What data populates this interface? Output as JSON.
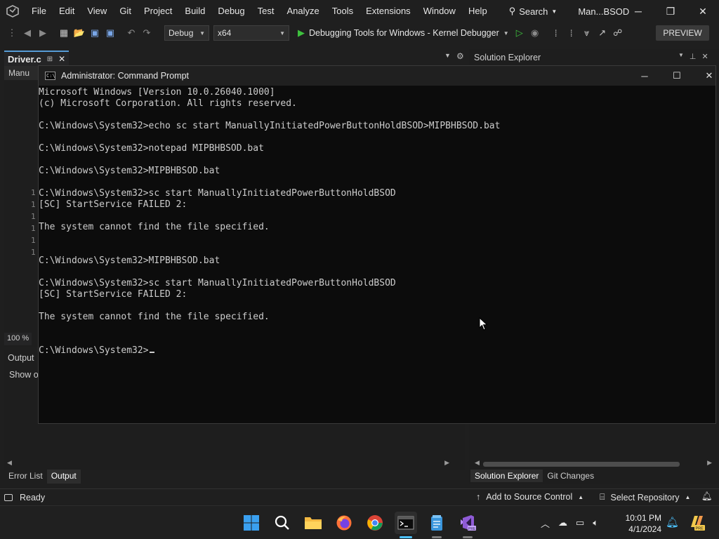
{
  "menubar": {
    "items": [
      "File",
      "Edit",
      "View",
      "Git",
      "Project",
      "Build",
      "Debug",
      "Test",
      "Analyze",
      "Tools",
      "Extensions",
      "Window",
      "Help"
    ],
    "search_label": "Search",
    "title": "Man...BSOD"
  },
  "toolbar": {
    "configuration": "Debug",
    "platform": "x64",
    "debug_target": "Debugging Tools for Windows - Kernel Debugger",
    "preview_label": "PREVIEW"
  },
  "doc_tabs": {
    "active_tab": "Driver.c",
    "editor_strip": "Manu"
  },
  "editor": {
    "line_numbers": [
      "1",
      "1",
      "1",
      "1",
      "1",
      "1"
    ],
    "zoom": "100 %"
  },
  "output": {
    "title": "Output",
    "show_output": "Show o"
  },
  "bottom_tabs": [
    "Error List",
    "Output"
  ],
  "solution_explorer": {
    "title": "Solution Explorer",
    "tabs": [
      "Solution Explorer",
      "Git Changes"
    ]
  },
  "statusbar": {
    "ready": "Ready",
    "add_to_source_control": "Add to Source Control",
    "select_repository": "Select Repository"
  },
  "cmd": {
    "title": "Administrator: Command Prompt",
    "lines": [
      "Microsoft Windows [Version 10.0.26040.1000]",
      "(c) Microsoft Corporation. All rights reserved.",
      "",
      "C:\\Windows\\System32>echo sc start ManuallyInitiatedPowerButtonHoldBSOD>MIPBHBSOD.bat",
      "",
      "C:\\Windows\\System32>notepad MIPBHBSOD.bat",
      "",
      "C:\\Windows\\System32>MIPBHBSOD.bat",
      "",
      "C:\\Windows\\System32>sc start ManuallyInitiatedPowerButtonHoldBSOD",
      "[SC] StartService FAILED 2:",
      "",
      "The system cannot find the file specified.",
      "",
      "",
      "C:\\Windows\\System32>MIPBHBSOD.bat",
      "",
      "C:\\Windows\\System32>sc start ManuallyInitiatedPowerButtonHoldBSOD",
      "[SC] StartService FAILED 2:",
      "",
      "The system cannot find the file specified.",
      "",
      "",
      "C:\\Windows\\System32>"
    ]
  },
  "taskbar": {
    "apps": [
      "start-icon",
      "search-icon",
      "file-explorer-icon",
      "firefox-icon",
      "chrome-icon",
      "terminal-icon",
      "notepad-icon",
      "visual-studio-icon"
    ],
    "time": "10:01 PM",
    "date": "4/1/2024"
  },
  "colors": {
    "accent_blue": "#569cd6",
    "run_green": "#3ec13e",
    "vs_purple": "#8f5bd7",
    "cmd_background": "#0c0c0c"
  }
}
